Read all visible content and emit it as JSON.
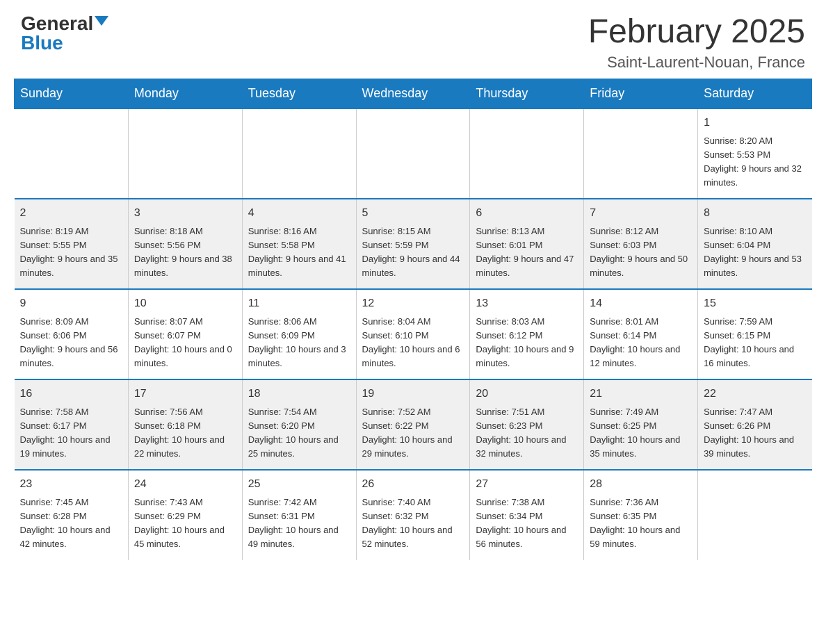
{
  "header": {
    "logo_general": "General",
    "logo_blue": "Blue",
    "month_title": "February 2025",
    "location": "Saint-Laurent-Nouan, France"
  },
  "weekdays": [
    "Sunday",
    "Monday",
    "Tuesday",
    "Wednesday",
    "Thursday",
    "Friday",
    "Saturday"
  ],
  "weeks": [
    [
      {
        "day": "",
        "info": ""
      },
      {
        "day": "",
        "info": ""
      },
      {
        "day": "",
        "info": ""
      },
      {
        "day": "",
        "info": ""
      },
      {
        "day": "",
        "info": ""
      },
      {
        "day": "",
        "info": ""
      },
      {
        "day": "1",
        "info": "Sunrise: 8:20 AM\nSunset: 5:53 PM\nDaylight: 9 hours and 32 minutes."
      }
    ],
    [
      {
        "day": "2",
        "info": "Sunrise: 8:19 AM\nSunset: 5:55 PM\nDaylight: 9 hours and 35 minutes."
      },
      {
        "day": "3",
        "info": "Sunrise: 8:18 AM\nSunset: 5:56 PM\nDaylight: 9 hours and 38 minutes."
      },
      {
        "day": "4",
        "info": "Sunrise: 8:16 AM\nSunset: 5:58 PM\nDaylight: 9 hours and 41 minutes."
      },
      {
        "day": "5",
        "info": "Sunrise: 8:15 AM\nSunset: 5:59 PM\nDaylight: 9 hours and 44 minutes."
      },
      {
        "day": "6",
        "info": "Sunrise: 8:13 AM\nSunset: 6:01 PM\nDaylight: 9 hours and 47 minutes."
      },
      {
        "day": "7",
        "info": "Sunrise: 8:12 AM\nSunset: 6:03 PM\nDaylight: 9 hours and 50 minutes."
      },
      {
        "day": "8",
        "info": "Sunrise: 8:10 AM\nSunset: 6:04 PM\nDaylight: 9 hours and 53 minutes."
      }
    ],
    [
      {
        "day": "9",
        "info": "Sunrise: 8:09 AM\nSunset: 6:06 PM\nDaylight: 9 hours and 56 minutes."
      },
      {
        "day": "10",
        "info": "Sunrise: 8:07 AM\nSunset: 6:07 PM\nDaylight: 10 hours and 0 minutes."
      },
      {
        "day": "11",
        "info": "Sunrise: 8:06 AM\nSunset: 6:09 PM\nDaylight: 10 hours and 3 minutes."
      },
      {
        "day": "12",
        "info": "Sunrise: 8:04 AM\nSunset: 6:10 PM\nDaylight: 10 hours and 6 minutes."
      },
      {
        "day": "13",
        "info": "Sunrise: 8:03 AM\nSunset: 6:12 PM\nDaylight: 10 hours and 9 minutes."
      },
      {
        "day": "14",
        "info": "Sunrise: 8:01 AM\nSunset: 6:14 PM\nDaylight: 10 hours and 12 minutes."
      },
      {
        "day": "15",
        "info": "Sunrise: 7:59 AM\nSunset: 6:15 PM\nDaylight: 10 hours and 16 minutes."
      }
    ],
    [
      {
        "day": "16",
        "info": "Sunrise: 7:58 AM\nSunset: 6:17 PM\nDaylight: 10 hours and 19 minutes."
      },
      {
        "day": "17",
        "info": "Sunrise: 7:56 AM\nSunset: 6:18 PM\nDaylight: 10 hours and 22 minutes."
      },
      {
        "day": "18",
        "info": "Sunrise: 7:54 AM\nSunset: 6:20 PM\nDaylight: 10 hours and 25 minutes."
      },
      {
        "day": "19",
        "info": "Sunrise: 7:52 AM\nSunset: 6:22 PM\nDaylight: 10 hours and 29 minutes."
      },
      {
        "day": "20",
        "info": "Sunrise: 7:51 AM\nSunset: 6:23 PM\nDaylight: 10 hours and 32 minutes."
      },
      {
        "day": "21",
        "info": "Sunrise: 7:49 AM\nSunset: 6:25 PM\nDaylight: 10 hours and 35 minutes."
      },
      {
        "day": "22",
        "info": "Sunrise: 7:47 AM\nSunset: 6:26 PM\nDaylight: 10 hours and 39 minutes."
      }
    ],
    [
      {
        "day": "23",
        "info": "Sunrise: 7:45 AM\nSunset: 6:28 PM\nDaylight: 10 hours and 42 minutes."
      },
      {
        "day": "24",
        "info": "Sunrise: 7:43 AM\nSunset: 6:29 PM\nDaylight: 10 hours and 45 minutes."
      },
      {
        "day": "25",
        "info": "Sunrise: 7:42 AM\nSunset: 6:31 PM\nDaylight: 10 hours and 49 minutes."
      },
      {
        "day": "26",
        "info": "Sunrise: 7:40 AM\nSunset: 6:32 PM\nDaylight: 10 hours and 52 minutes."
      },
      {
        "day": "27",
        "info": "Sunrise: 7:38 AM\nSunset: 6:34 PM\nDaylight: 10 hours and 56 minutes."
      },
      {
        "day": "28",
        "info": "Sunrise: 7:36 AM\nSunset: 6:35 PM\nDaylight: 10 hours and 59 minutes."
      },
      {
        "day": "",
        "info": ""
      }
    ]
  ]
}
